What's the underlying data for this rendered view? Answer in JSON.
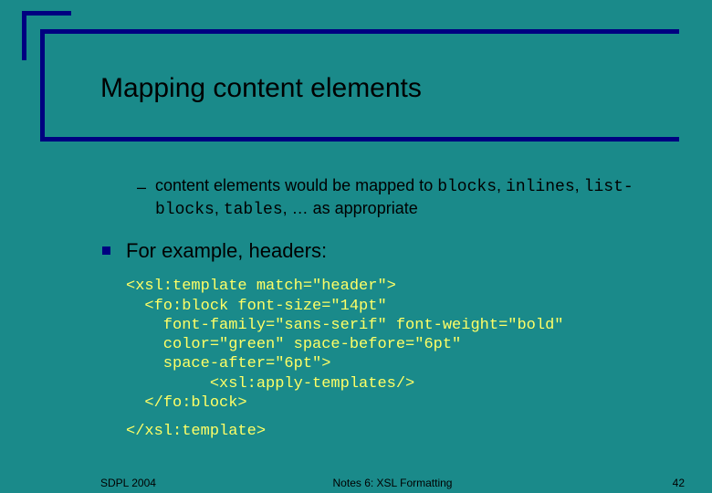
{
  "title": "Mapping content elements",
  "sub": {
    "dash": "–",
    "text1": "content elements would be mapped to ",
    "code1": "blocks",
    "sep1": ", ",
    "code2": "inlines",
    "sep2": ", ",
    "code3": "list-blocks",
    "sep3": ", ",
    "code4": "tables",
    "text2": ", … as appropriate"
  },
  "main": {
    "text": "For example, headers:"
  },
  "code": {
    "l1": "<xsl:template match=\"header\">",
    "l2": "  <fo:block font-size=\"14pt\"",
    "l3": "    font-family=\"sans-serif\" font-weight=\"bold\"",
    "l4": "    color=\"green\" space-before=\"6pt\"",
    "l5": "    space-after=\"6pt\">",
    "l6": "         <xsl:apply-templates/>",
    "l7": "  </fo:block>",
    "end": "</xsl:template>"
  },
  "footer": {
    "left": "SDPL 2004",
    "center": "Notes 6: XSL Formatting",
    "right": "42"
  }
}
